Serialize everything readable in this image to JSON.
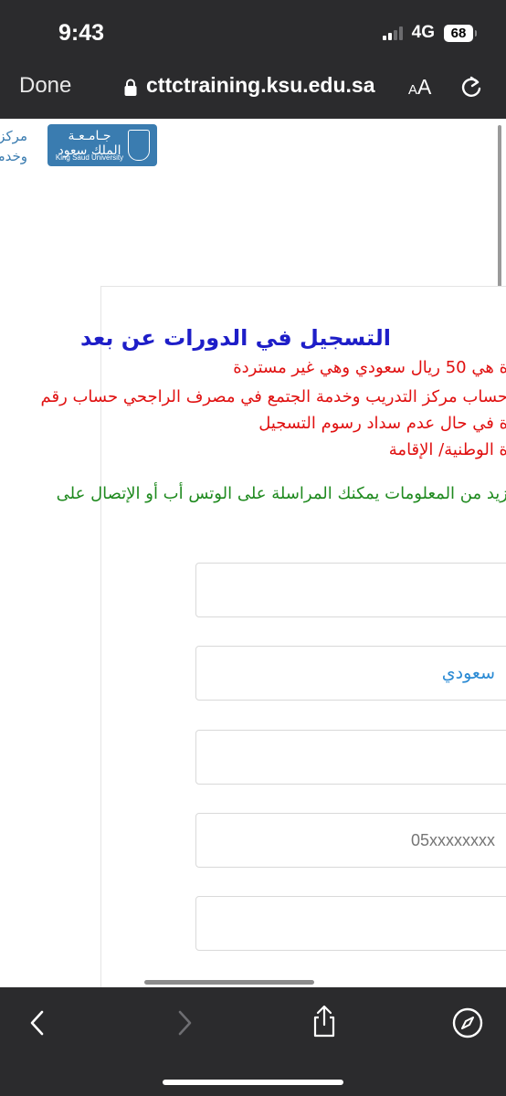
{
  "status_bar": {
    "time": "9:43",
    "network": "4G",
    "battery": "68"
  },
  "browser": {
    "done_label": "Done",
    "url": "cttctraining.ksu.edu.sa",
    "text_size_small": "A",
    "text_size_large": "A",
    "icons": [
      "lock-icon",
      "reload-icon",
      "back-icon",
      "forward-icon",
      "share-icon",
      "compass-icon"
    ]
  },
  "logo": {
    "arabic_line1": "جـامـعـة",
    "arabic_line2": "الملك سعود",
    "english": "King Saud University"
  },
  "side_text": {
    "line1": "مركز",
    "line2": "وخدمة"
  },
  "page": {
    "heading": "التسجيل في الدورات عن بعد",
    "info_lines": [
      "ة هي 50 ريال سعودي وهي غير مستردة",
      "حساب مركز التدريب وخدمة الجتمع في مصرف الراجحي حساب رقم",
      "ة في حال عدم سداد رسوم التسجيل",
      "ة الوطنية/ الإقامة"
    ],
    "contact_line": "زيد من المعلومات يمكنك المراسلة على الوتس أب أو الإتصال على"
  },
  "form": {
    "fields": [
      {
        "value": "",
        "placeholder": ""
      },
      {
        "value": "سعودي",
        "placeholder": ""
      },
      {
        "value": "",
        "placeholder": ""
      },
      {
        "value": "",
        "placeholder": "05xxxxxxxx"
      },
      {
        "value": "",
        "placeholder": ""
      }
    ]
  },
  "colors": {
    "toolbar_bg": "#2b2b2d",
    "heading": "#1e1ec8",
    "warning_text": "#e01010",
    "contact_text": "#1f8a1f",
    "logo_bg": "#3a7cb0",
    "field_value": "#2a8ad4"
  }
}
